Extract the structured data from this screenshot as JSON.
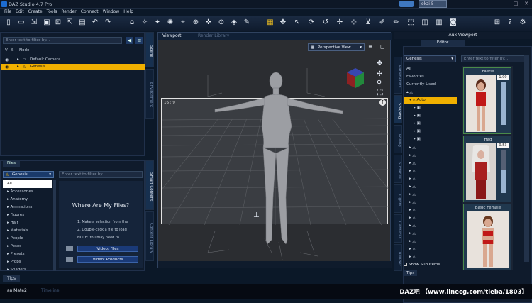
{
  "app": {
    "title": "DAZ Studio 4.7 Pro"
  },
  "menu": [
    "File",
    "Edit",
    "Create",
    "Tools",
    "Render",
    "Connect",
    "Window",
    "Help"
  ],
  "top_field": "okzi 5",
  "scene_panel": {
    "filter_placeholder": "Enter text to filter by...",
    "columns": [
      "V",
      "S",
      "Node"
    ],
    "nodes": [
      {
        "label": "Default Camera",
        "selected": false
      },
      {
        "label": "Genesis",
        "selected": true
      }
    ]
  },
  "left_side_tabs": [
    "Scene",
    "Environment",
    "Smart Content",
    "Content Library"
  ],
  "files_panel": {
    "tab": "Files",
    "dropdown": "Genesis",
    "filter_placeholder": "Enter text to filter by...",
    "categories": [
      "All",
      "Accessories",
      "Anatomy",
      "Animations",
      "Figures",
      "Hair",
      "Materials",
      "People",
      "Poses",
      "Presets",
      "Props",
      "Shaders"
    ],
    "selected_category": "All",
    "help_title": "Where Are My Files?",
    "help_steps": [
      "1. Make a selection from the",
      "2. Double-click a file to load",
      "NOTE: You may need to"
    ],
    "video_buttons": [
      "Video: Files",
      "Video: Products"
    ],
    "tips_tab": "Tips"
  },
  "viewport": {
    "tabs": [
      "Viewport",
      "Render Library"
    ],
    "camera": "Perspective View",
    "aspect_ratio": "16 : 9"
  },
  "right_side_tabs": [
    "Parameters",
    "Shaping",
    "Posing",
    "Surfaces",
    "Lights",
    "Cameras",
    "Render"
  ],
  "aux_panel": {
    "title": "Aux Viewport",
    "editor_tab": "Editor",
    "dropdown": "Genesis",
    "filter_placeholder": "Enter text to filter by...",
    "items": [
      "All",
      "Favorites",
      "Currently Used"
    ],
    "tree_selected": "Actor",
    "morph_tiles": [
      {
        "name": "Faerie",
        "value": "1.00",
        "level": 1.0
      },
      {
        "name": "Hag",
        "value": "0.53",
        "level": 0.53
      },
      {
        "name": "Basic Female",
        "value": "",
        "level": 0
      }
    ],
    "show_sub_items": "Show Sub Items",
    "tips_tab": "Tips"
  },
  "status_bar": {
    "tabs": [
      "aniMate2",
      "Timeline"
    ],
    "watermark": "DAZ吧 【www.linecg.com/tieba/1803】"
  },
  "colors": {
    "selection": "#f0b000",
    "accent": "#1a3a78",
    "background": "#0b1828"
  }
}
